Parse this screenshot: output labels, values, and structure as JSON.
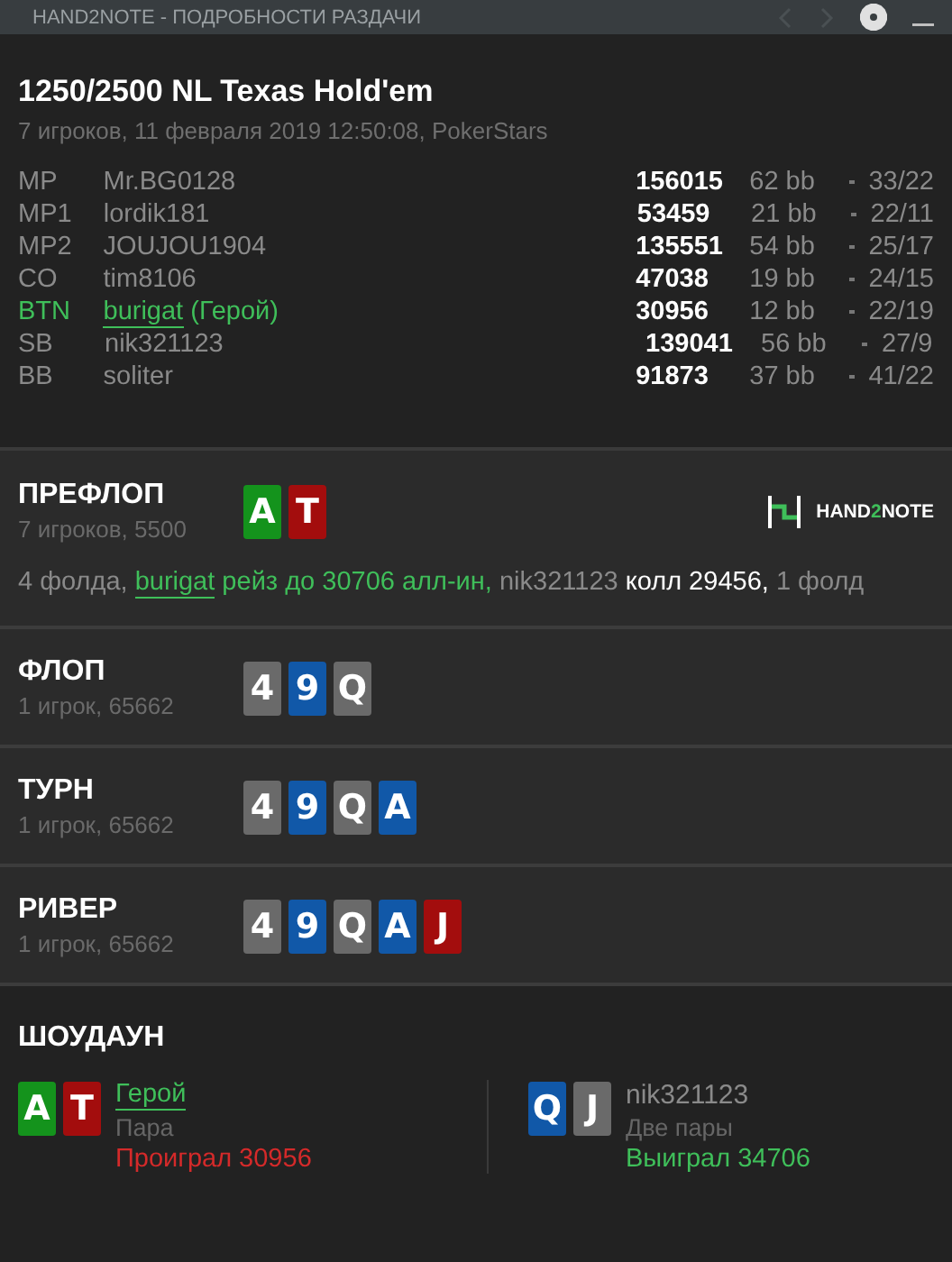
{
  "window": {
    "title": "HAND2NOTE - ПОДРОБНОСТИ РАЗДАЧИ",
    "prev_disabled": true,
    "next_disabled": true
  },
  "hand": {
    "title": "1250/2500 NL Texas Hold'em",
    "subtitle": "7 игроков, 11 февраля 2019 12:50:08, PokerStars"
  },
  "players": [
    {
      "position": "MP",
      "name": "Mr.BG0128",
      "hero": false,
      "stack": "156015",
      "bb": "62 bb",
      "stats": "33/22"
    },
    {
      "position": "MP1",
      "name": "lordik181",
      "hero": false,
      "stack": "53459",
      "bb": "21 bb",
      "stats": "22/11"
    },
    {
      "position": "MP2",
      "name": "JOUJOU1904",
      "hero": false,
      "stack": "135551",
      "bb": "54 bb",
      "stats": "25/17"
    },
    {
      "position": "CO",
      "name": "tim8106",
      "hero": false,
      "stack": "47038",
      "bb": "19 bb",
      "stats": "24/15"
    },
    {
      "position": "BTN",
      "name": "burigat",
      "hero": true,
      "hero_label": "(Герой)",
      "stack": "30956",
      "bb": "12 bb",
      "stats": "22/19"
    },
    {
      "position": "SB",
      "name": "nik321123",
      "hero": false,
      "stack": "139041",
      "bb": "56 bb",
      "stats": "27/9"
    },
    {
      "position": "BB",
      "name": "soliter",
      "hero": false,
      "stack": "91873",
      "bb": "37 bb",
      "stats": "41/22"
    }
  ],
  "streets": [
    {
      "name": "ПРЕФЛОП",
      "info": "7 игроков, 5500",
      "cards": [
        {
          "rank": "A",
          "color": "#14931c"
        },
        {
          "rank": "T",
          "color": "#a30d0d"
        }
      ],
      "logo": {
        "before": "HAND",
        "accent": "2",
        "after": "NOTE"
      },
      "actions": [
        {
          "kind": "text",
          "text": "4 фолда, "
        },
        {
          "kind": "link",
          "text": "burigat"
        },
        {
          "kind": "raise",
          "text": " рейз до 30706 алл-ин, "
        },
        {
          "kind": "text",
          "text": "nik321123 "
        },
        {
          "kind": "call",
          "text": "колл 29456, "
        },
        {
          "kind": "text",
          "text": "1 фолд"
        }
      ]
    },
    {
      "name": "ФЛОП",
      "info": "1 игрок, 65662",
      "cards": [
        {
          "rank": "4",
          "color": "#6a6a6a"
        },
        {
          "rank": "9",
          "color": "#1158a8"
        },
        {
          "rank": "Q",
          "color": "#6a6a6a"
        }
      ]
    },
    {
      "name": "ТУРН",
      "info": "1 игрок, 65662",
      "cards": [
        {
          "rank": "4",
          "color": "#6a6a6a"
        },
        {
          "rank": "9",
          "color": "#1158a8"
        },
        {
          "rank": "Q",
          "color": "#6a6a6a"
        },
        {
          "rank": "A",
          "color": "#1158a8"
        }
      ]
    },
    {
      "name": "РИВЕР",
      "info": "1 игрок, 65662",
      "cards": [
        {
          "rank": "4",
          "color": "#6a6a6a"
        },
        {
          "rank": "9",
          "color": "#1158a8"
        },
        {
          "rank": "Q",
          "color": "#6a6a6a"
        },
        {
          "rank": "A",
          "color": "#1158a8"
        },
        {
          "rank": "J",
          "color": "#a30d0d"
        }
      ]
    }
  ],
  "showdown": {
    "title": "ШОУДАУН",
    "hands": [
      {
        "player": "Герой",
        "hero": true,
        "cards": [
          {
            "rank": "A",
            "color": "#14931c"
          },
          {
            "rank": "T",
            "color": "#a30d0d"
          }
        ],
        "combination": "Пара",
        "won": false,
        "amount": "Проиграл 30956"
      },
      {
        "player": "nik321123",
        "hero": false,
        "cards": [
          {
            "rank": "Q",
            "color": "#1158a8"
          },
          {
            "rank": "J",
            "color": "#6a6a6a"
          }
        ],
        "combination": "Две пары",
        "won": true,
        "amount": "Выиграл 34706"
      }
    ]
  }
}
